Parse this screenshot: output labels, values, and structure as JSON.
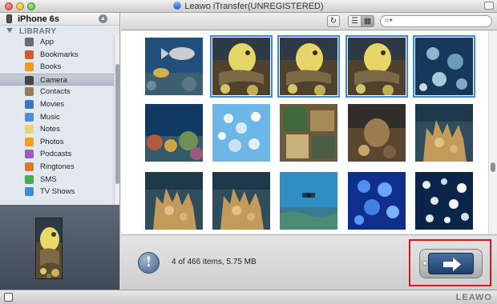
{
  "window": {
    "title": "Leawo iTransfer(UNREGISTERED)"
  },
  "sidebar": {
    "device_name": "iPhone 6s",
    "section_label": "LIBRARY",
    "items": [
      {
        "label": "App",
        "icon": "app-store-icon",
        "color": "#6d6d6d"
      },
      {
        "label": "Bookmarks",
        "icon": "bookmark-icon",
        "color": "#d45a2a"
      },
      {
        "label": "Books",
        "icon": "book-icon",
        "color": "#f29b1e"
      },
      {
        "label": "Camera",
        "icon": "camera-icon",
        "color": "#444444",
        "selected": true
      },
      {
        "label": "Contacts",
        "icon": "contacts-icon",
        "color": "#9b7c57"
      },
      {
        "label": "Movies",
        "icon": "movie-icon",
        "color": "#3a76c9"
      },
      {
        "label": "Music",
        "icon": "music-icon",
        "color": "#4a8edc"
      },
      {
        "label": "Notes",
        "icon": "notes-icon",
        "color": "#e9d47a"
      },
      {
        "label": "Photos",
        "icon": "photos-icon",
        "color": "#f0a21c"
      },
      {
        "label": "Podcasts",
        "icon": "podcast-icon",
        "color": "#9f56c7"
      },
      {
        "label": "Ringtones",
        "icon": "ringtone-icon",
        "color": "#e17a1b"
      },
      {
        "label": "SMS",
        "icon": "sms-icon",
        "color": "#3db34a"
      },
      {
        "label": "TV Shows",
        "icon": "tv-icon",
        "color": "#3a8fd8"
      }
    ]
  },
  "toolbar": {
    "refresh_label": "↻",
    "list_view_label": "☰",
    "grid_view_label": "▦",
    "search_placeholder": ""
  },
  "status": {
    "item_count_text": "4 of 466 items, 5.75 MB"
  },
  "statusbar": {
    "brand": "LEAWO"
  },
  "photos": [
    {
      "style": "fish",
      "selected": false
    },
    {
      "style": "yellow",
      "selected": true
    },
    {
      "style": "yellow",
      "selected": true
    },
    {
      "style": "yellow",
      "selected": true
    },
    {
      "style": "jelly",
      "selected": true
    },
    {
      "style": "reef",
      "selected": false
    },
    {
      "style": "school",
      "selected": false
    },
    {
      "style": "collage",
      "selected": false
    },
    {
      "style": "brown",
      "selected": false
    },
    {
      "style": "coral",
      "selected": false
    },
    {
      "style": "coral",
      "selected": false
    },
    {
      "style": "coral",
      "selected": false
    },
    {
      "style": "diver",
      "selected": false
    },
    {
      "style": "bluejelly",
      "selected": false
    },
    {
      "style": "jelly2",
      "selected": false
    }
  ]
}
